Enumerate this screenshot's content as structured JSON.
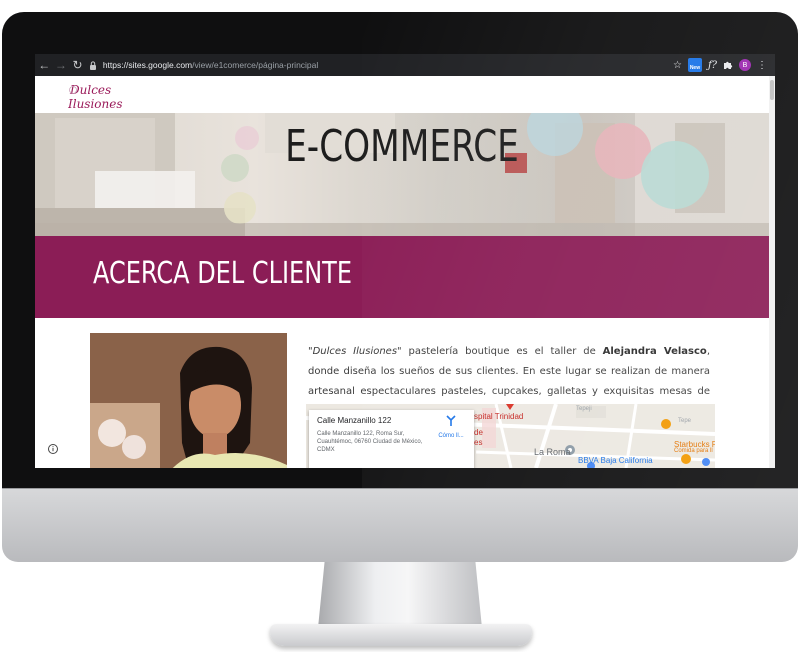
{
  "browser": {
    "url_host": "https://sites.google.com",
    "url_path": "/view/e1comerce/página-principal",
    "ext_new_label": "New",
    "ext_f_label": "ƒ?",
    "profile_initial": "B"
  },
  "site": {
    "logo_line1": "Dulces",
    "logo_line2": "Ilusiones",
    "hero_title": "E-COMMERCE",
    "banner_title": "ACERCA DEL CLIENTE",
    "desc": {
      "brand": "\"Dulces Ilusiones\"",
      "text1": " pastelería boutique es el taller de ",
      "owner": "Alejandra Velasco",
      "text2": ", donde diseña los sueños de sus clientes. En este lugar se realizan de manera artesanal espectaculares pasteles, cupcakes, galletas y exquisitas mesas de dulces para todo tipo de celebraciones."
    }
  },
  "map": {
    "place_title": "Calle Manzanillo 122",
    "place_address": "Calle Manzanillo 122, Roma Sur, Cuauhtémoc, 06760 Ciudad de México, CDMX",
    "directions_label": "Cómo ll...",
    "labels": {
      "hospital": "spital Trinidad",
      "de": "de",
      "es": "es",
      "la_roma": "La Roma",
      "bbva": "BBVA Baja California",
      "tepeji1": "Tepeji",
      "tepeji2": "Tepe",
      "starbucks": "Starbucks R",
      "starbucks_sub": "Comida para ll"
    }
  },
  "colors": {
    "brand_magenta": "#8b1d56",
    "logo_pink": "#9b1b5a"
  }
}
